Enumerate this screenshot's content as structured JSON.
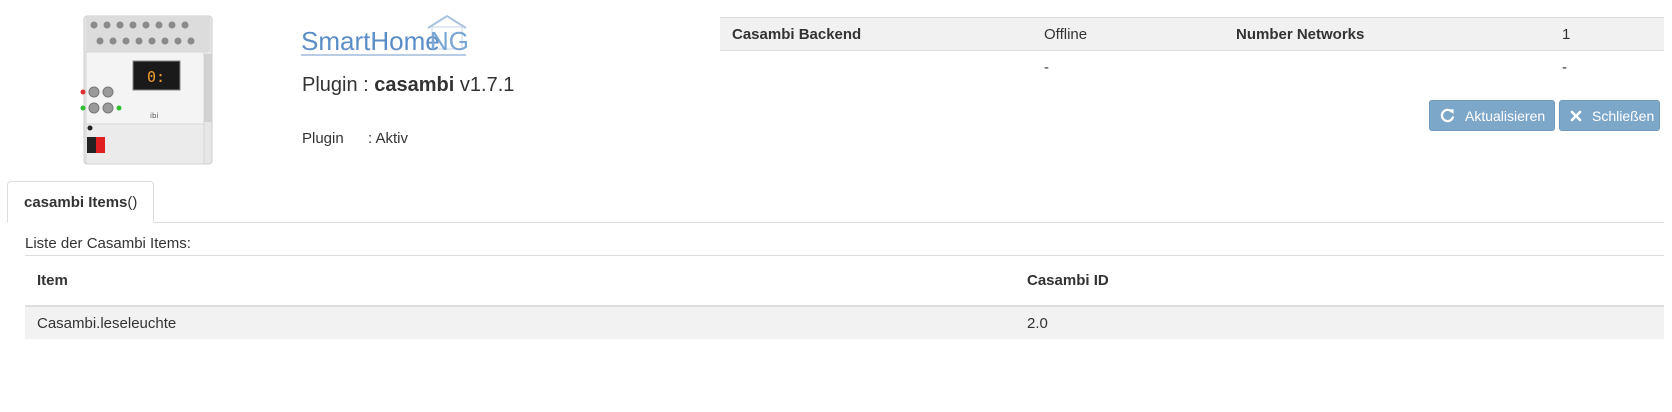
{
  "header": {
    "logo": {
      "smart": "SmartHome",
      "ng": "NG"
    },
    "device_display": "0:",
    "plugin_prefix": "Plugin : ",
    "plugin_name": "casambi",
    "plugin_version": " v1.7.1",
    "state_label": "Plugin",
    "state_value": ": Aktiv"
  },
  "info": {
    "rows": [
      {
        "c1": "Casambi Backend",
        "c2": "Offline",
        "c3": "Number Networks",
        "c4": "1"
      },
      {
        "c1": "",
        "c2": "-",
        "c3": "",
        "c4": "-"
      }
    ]
  },
  "buttons": {
    "refresh": {
      "label": "Aktualisieren",
      "icon": "refresh-icon"
    },
    "close": {
      "label": "Schließen",
      "icon": "close-icon"
    }
  },
  "colors": {
    "button": "#7da7c9",
    "logo_blue": "#5b8ec7",
    "row_bg": "#f2f2f2"
  },
  "tab": {
    "bold": "casambi Items",
    "suffix": " ()"
  },
  "list": {
    "caption": "Liste der Casambi Items:",
    "columns": [
      "Item",
      "Casambi ID"
    ],
    "rows": [
      {
        "item": "Casambi.leseleuchte",
        "id": "2.0"
      }
    ]
  }
}
